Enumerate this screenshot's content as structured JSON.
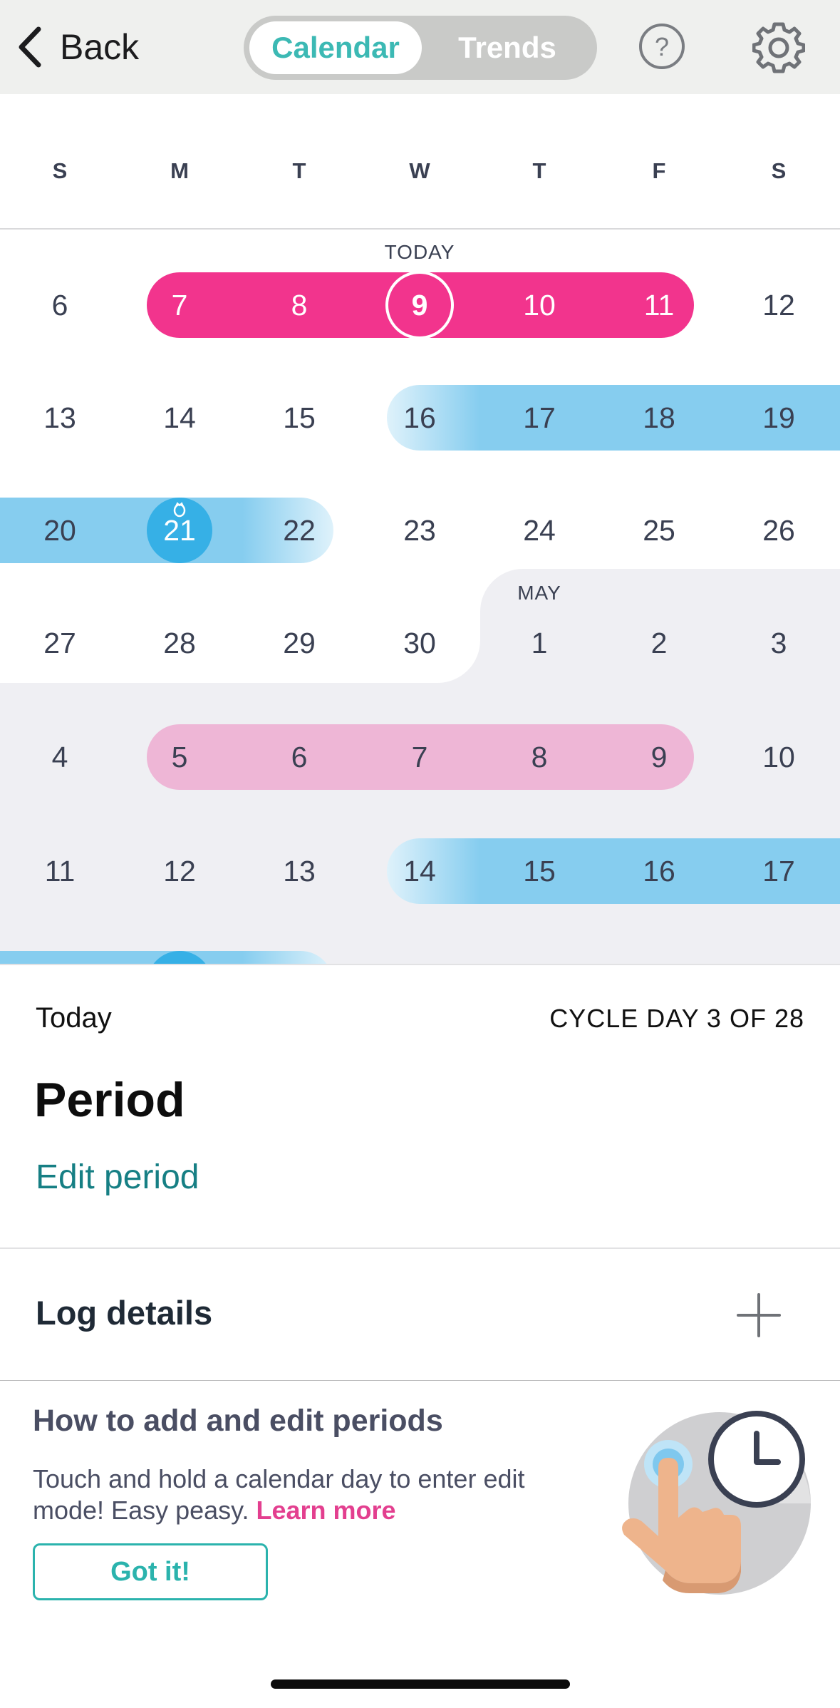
{
  "header": {
    "back_label": "Back",
    "tabs": [
      {
        "label": "Calendar",
        "active": true
      },
      {
        "label": "Trends",
        "active": false
      }
    ],
    "help_icon": "question-circle-icon",
    "settings_icon": "gear-icon"
  },
  "weekdays": [
    "S",
    "M",
    "T",
    "W",
    "T",
    "F",
    "S"
  ],
  "calendar": {
    "today_label": "TODAY",
    "may_label": "MAY",
    "weeks": [
      [
        "6",
        "7",
        "8",
        "9",
        "10",
        "11",
        "12"
      ],
      [
        "13",
        "14",
        "15",
        "16",
        "17",
        "18",
        "19"
      ],
      [
        "20",
        "21",
        "22",
        "23",
        "24",
        "25",
        "26"
      ],
      [
        "27",
        "28",
        "29",
        "30",
        "1",
        "2",
        "3"
      ],
      [
        "4",
        "5",
        "6",
        "7",
        "8",
        "9",
        "10"
      ],
      [
        "11",
        "12",
        "13",
        "14",
        "15",
        "16",
        "17"
      ]
    ],
    "colors": {
      "period": "#f2348d",
      "predicted_period": "#eeb6d6",
      "fertile": "#86cdef",
      "ovulation": "#36b0e6",
      "next_month_bg": "#efeff3"
    }
  },
  "today_panel": {
    "today_label": "Today",
    "cycle_day": "CYCLE DAY 3 OF 28",
    "phase": "Period",
    "edit_link": "Edit period"
  },
  "log": {
    "label": "Log details",
    "add_icon": "plus-icon"
  },
  "tip": {
    "title": "How to add and edit periods",
    "body": "Touch and hold a calendar day to enter edit mode! Easy peasy.",
    "link": "Learn more",
    "button": "Got it!",
    "illustration": "hand-tap-clock-icon"
  }
}
